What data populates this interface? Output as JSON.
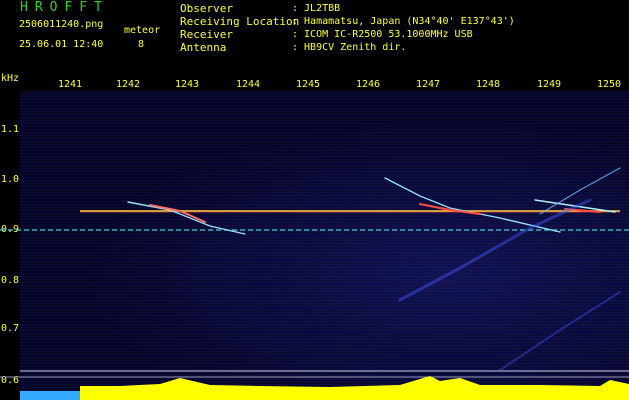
{
  "header": {
    "app_title": "HROFFT",
    "filename": "2506011240.png",
    "timestamp": "25.06.01 12:40",
    "meteor_label": "meteor",
    "meteor_count": "8",
    "info": [
      {
        "key": "Observer",
        "value": ": JL2TBB"
      },
      {
        "key": "Receiving Location",
        "value": ": Hamamatsu, Japan (N34°40' E137°43')"
      },
      {
        "key": "Receiver",
        "value": ": ICOM IC-R2500 53.1000MHz USB"
      },
      {
        "key": "Antenna",
        "value": ": HB9CV Zenith dir."
      }
    ]
  },
  "spectrogram": {
    "y_unit": "kHz",
    "x_ticks": [
      "1241",
      "1242",
      "1243",
      "1244",
      "1245",
      "1246",
      "1247",
      "1248",
      "1249",
      "1250"
    ],
    "y_ticks": [
      "1.1",
      "1.0",
      "0.9",
      "0.8",
      "0.7",
      "0.6"
    ],
    "carrier_khz": 0.94,
    "reference_khz": 0.9,
    "colors": {
      "text": "#ffff33",
      "title": "#26d226",
      "background": "#05052a",
      "level_bar": "#ffff00",
      "level_bar_start": "#33aaff"
    }
  }
}
